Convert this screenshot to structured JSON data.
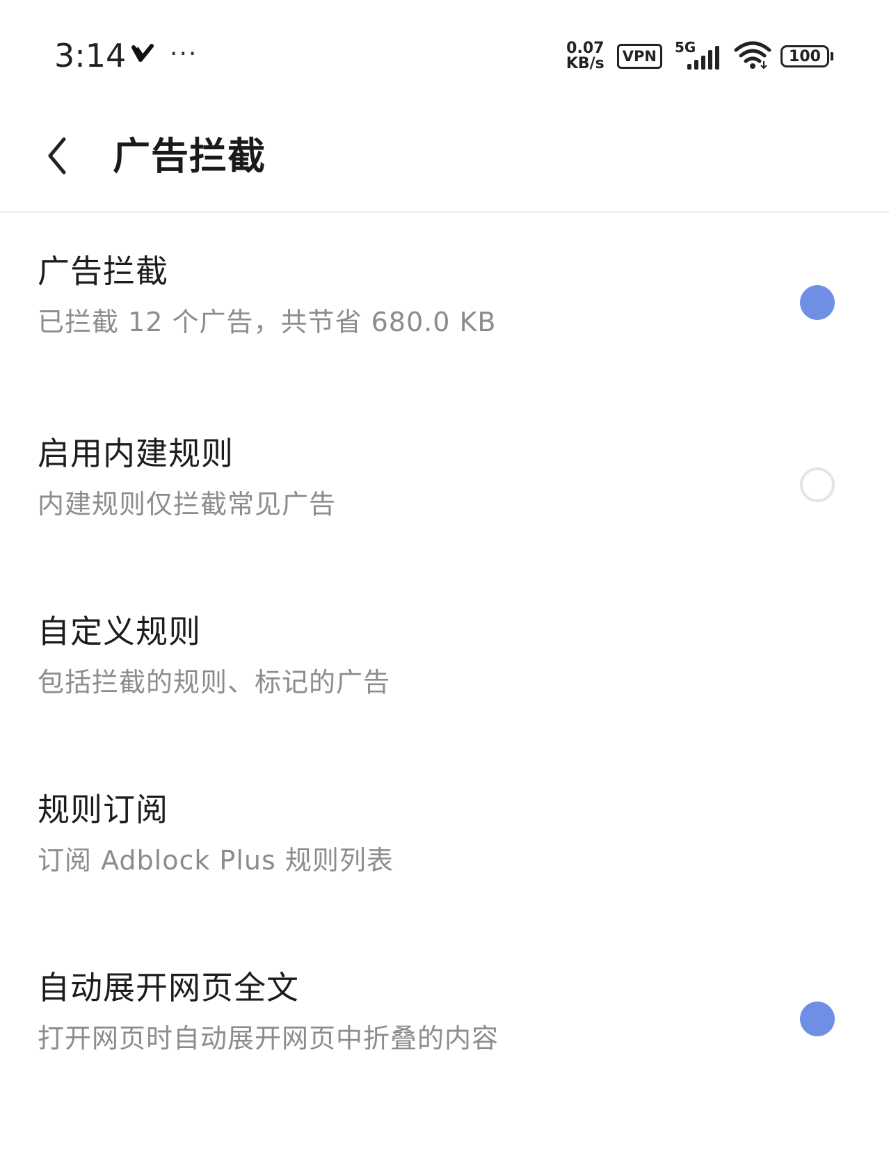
{
  "status_bar": {
    "time": "3:14",
    "more": "···",
    "net_speed_value": "0.07",
    "net_speed_unit": "KB/s",
    "vpn": "VPN",
    "network_type": "5G",
    "battery": "100"
  },
  "header": {
    "title": "广告拦截"
  },
  "settings": [
    {
      "title": "广告拦截",
      "subtitle": "已拦截 12 个广告，共节省 680.0 KB",
      "toggle": true
    },
    {
      "title": "启用内建规则",
      "subtitle": "内建规则仅拦截常见广告",
      "toggle": false
    },
    {
      "title": "自定义规则",
      "subtitle": "包括拦截的规则、标记的广告"
    },
    {
      "title": "规则订阅",
      "subtitle": "订阅 Adblock Plus 规则列表"
    },
    {
      "title": "自动展开网页全文",
      "subtitle": "打开网页时自动展开网页中折叠的内容",
      "toggle": true
    }
  ],
  "colors": {
    "accent": "#6f8fe4",
    "toggle_off_border": "#e4e4e4",
    "subtitle": "#8c8c8c"
  }
}
